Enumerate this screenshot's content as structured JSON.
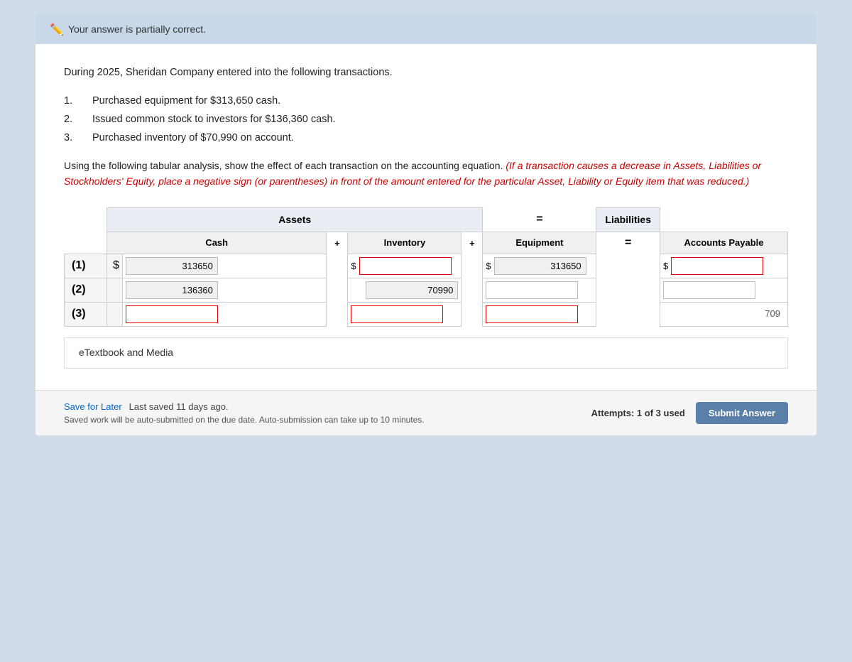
{
  "status_banner": {
    "icon": "✏",
    "text": "Your answer is partially correct."
  },
  "problem": {
    "intro": "During 2025, Sheridan Company entered into the following transactions.",
    "transactions": [
      {
        "num": "1.",
        "text": "Purchased equipment for $313,650 cash."
      },
      {
        "num": "2.",
        "text": "Issued common stock to investors for $136,360 cash."
      },
      {
        "num": "3.",
        "text": "Purchased inventory of $70,990 on account."
      }
    ],
    "instruction_start": "Using the following tabular analysis, show the effect of each transaction on the accounting equation. ",
    "instruction_italic": "(If a transaction causes a decrease in Assets, Liabilities or Stockholders' Equity, place a negative sign (or parentheses) in front of the amount entered for the particular Asset, Liability or Equity item that was reduced.)"
  },
  "table": {
    "header_assets": "Assets",
    "header_liabilities": "Liabilities",
    "equals_sign": "=",
    "sub_cash": "Cash",
    "sub_plus1": "+",
    "sub_inventory": "Inventory",
    "sub_plus2": "+",
    "sub_equipment": "Equipment",
    "sub_equals": "=",
    "sub_accounts_payable": "Accounts Payable",
    "rows": [
      {
        "id": "row1",
        "label": "(1)",
        "dollar_cash": "$",
        "cash_value": "313650",
        "cash_readonly": true,
        "dollar_inv": "$",
        "inv_value": "",
        "inv_red_border": true,
        "dollar_equip": "$",
        "equip_value": "313650",
        "equip_readonly": true,
        "dollar_ap": "$",
        "ap_value": "",
        "ap_red_border": true
      },
      {
        "id": "row2",
        "label": "(2)",
        "cash_value": "136360",
        "cash_readonly": true,
        "inv_value": "70990",
        "inv_readonly": true,
        "equip_value": "",
        "equip_red_border": false,
        "ap_value": "",
        "ap_red_border": false
      },
      {
        "id": "row3",
        "label": "(3)",
        "cash_value": "",
        "cash_red_border": true,
        "inv_value": "",
        "inv_red_border": true,
        "equip_value": "",
        "equip_red_border": true,
        "ap_value": "709",
        "ap_partial": true
      }
    ]
  },
  "etextbook": {
    "label": "eTextbook and Media"
  },
  "footer": {
    "save_label": "Save for Later",
    "last_saved": "Last saved 11 days ago.",
    "auto_submit": "Saved work will be auto-submitted on the due date. Auto-submission can take up to 10 minutes.",
    "attempts": "Attempts: 1 of 3 used",
    "submit_button": "Submit Answer"
  }
}
